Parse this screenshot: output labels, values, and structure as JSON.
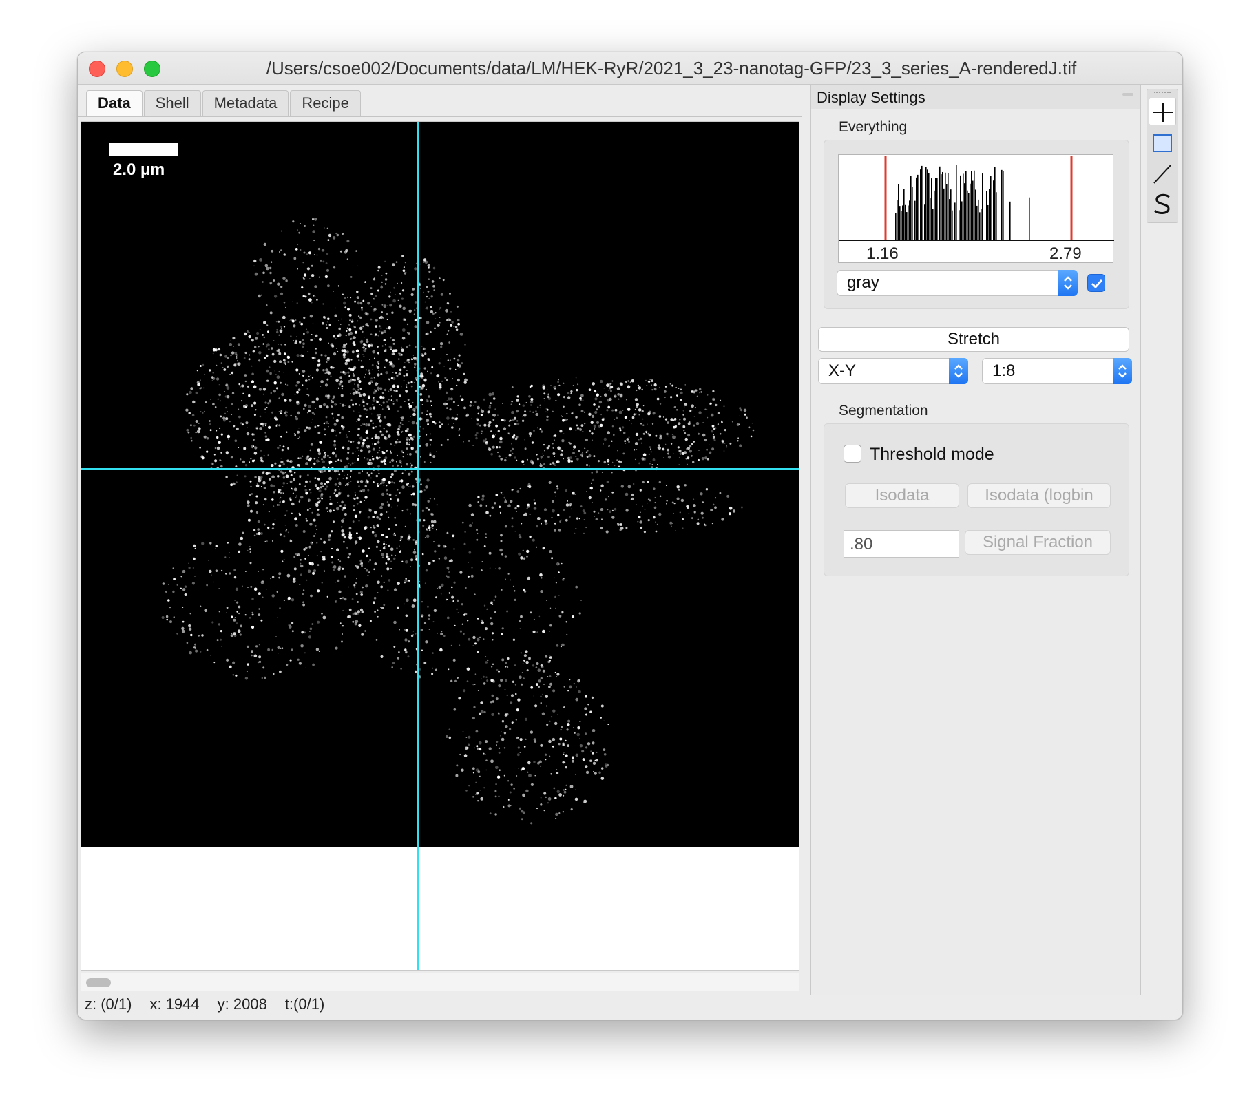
{
  "window": {
    "title": "/Users/csoe002/Documents/data/LM/HEK-RyR/2021_3_23-nanotag-GFP/23_3_series_A-renderedJ.tif"
  },
  "tabs": [
    {
      "label": "Data",
      "active": true
    },
    {
      "label": "Shell",
      "active": false
    },
    {
      "label": "Metadata",
      "active": false
    },
    {
      "label": "Recipe",
      "active": false
    }
  ],
  "image": {
    "scale_bar_label": "2.0 µm",
    "crosshair_color": "#33e0f0"
  },
  "status": {
    "z": "z: (0/1)",
    "x": "x: 1944",
    "y": "y: 2008",
    "t": "t:(0/1)"
  },
  "display_settings": {
    "title": "Display Settings",
    "group_label": "Everything",
    "histogram": {
      "min_label": "1.16",
      "max_label": "2.79",
      "marker_color": "#e03a2c"
    },
    "colormap": {
      "selected": "gray",
      "checked": true
    },
    "stretch_label": "Stretch",
    "slice_select": {
      "selected": "X-Y"
    },
    "zoom_select": {
      "selected": "1:8"
    },
    "segmentation": {
      "label": "Segmentation",
      "threshold_mode_label": "Threshold mode",
      "threshold_mode_checked": false,
      "isodata_label": "Isodata",
      "isodata_logbin_label": "Isodata (logbin",
      "fraction_value": ".80",
      "signal_fraction_label": "Signal Fraction"
    }
  },
  "toolbar": {
    "tools": [
      "crosshair-icon",
      "rectangle-select-icon",
      "line-tool-icon",
      "freehand-s-icon"
    ]
  },
  "colors": {
    "accent": "#2f7ff6",
    "traffic_close": "#fe5f57",
    "traffic_min": "#febc2e",
    "traffic_max": "#28c840"
  }
}
